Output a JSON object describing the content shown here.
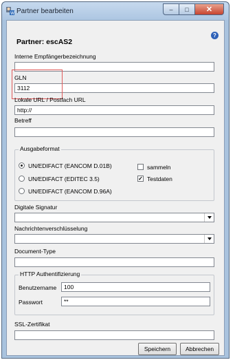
{
  "window": {
    "title": "Partner bearbeiten",
    "controls": {
      "minimize": "–",
      "maximize": "□",
      "close": "✕"
    }
  },
  "form": {
    "heading": "Partner: escAS2",
    "help_icon": "?",
    "fields": {
      "interne_empfaengerbezeichnung": {
        "label": "Interne Empfängerbezeichnung",
        "value": ""
      },
      "gln": {
        "label": "GLN",
        "value": "3112"
      },
      "lokale_url": {
        "label": "Lokale URL / Postfach URL",
        "value": "http://"
      },
      "betreff": {
        "label": "Betreff",
        "value": ""
      }
    },
    "ausgabeformat": {
      "title": "Ausgabeformat",
      "options": [
        {
          "label": "UN/EDIFACT (EANCOM D.01B)",
          "selected": true
        },
        {
          "label": "UN/EDIFACT (EDITEC 3.5)",
          "selected": false
        },
        {
          "label": "UN/EDIFACT (EANCOM D.96A)",
          "selected": false
        }
      ],
      "checkboxes": [
        {
          "label": "sammeln",
          "checked": false
        },
        {
          "label": "Testdaten",
          "checked": true
        }
      ]
    },
    "digitale_signatur": {
      "label": "Digitale Signatur",
      "value": ""
    },
    "nachrichtenverschluesselung": {
      "label": "Nachrichtenverschlüsselung",
      "value": ""
    },
    "document_type": {
      "label": "Document-Type",
      "value": ""
    },
    "http_auth": {
      "title": "HTTP Authentifizierung",
      "benutzername": {
        "label": "Benutzername",
        "value": "100"
      },
      "passwort": {
        "label": "Passwort",
        "value": "**"
      }
    },
    "ssl_zertifikat": {
      "label": "SSL-Zertifikat",
      "value": ""
    },
    "buttons": {
      "save": "Speichern",
      "cancel": "Abbrechen"
    }
  },
  "colors": {
    "title_bar": "#adc6e2",
    "client_bg": "#f0f0f0",
    "close_button": "#c64431",
    "highlight_box": "#e05a5a",
    "help_icon": "#2f62b8"
  },
  "icons": {
    "app": "partner-app-icon",
    "help": "help-icon",
    "combo": "chevron-down-icon"
  }
}
